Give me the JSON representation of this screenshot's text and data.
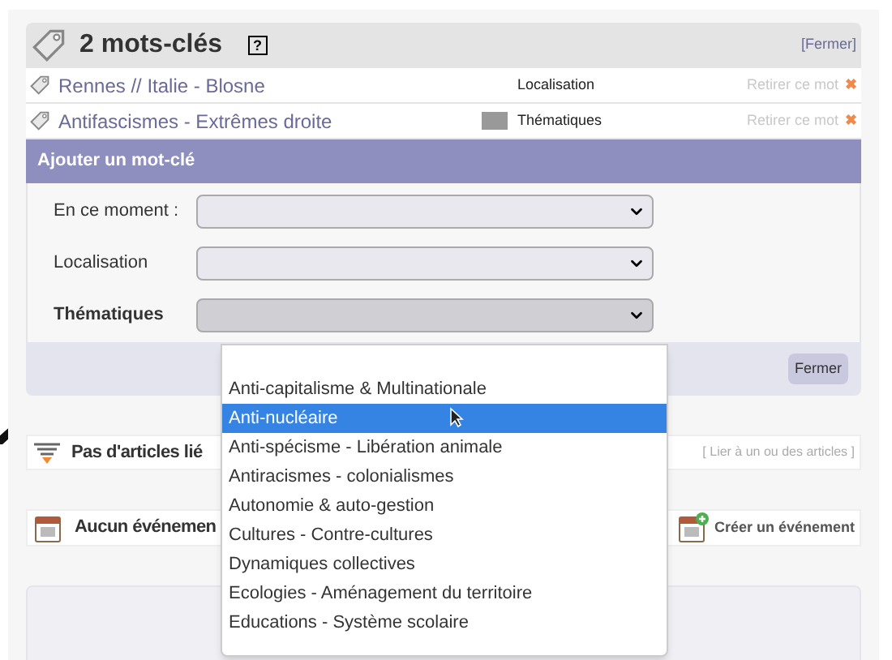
{
  "keywords_panel": {
    "title": "2 mots-clés",
    "help": "?",
    "close": "[Fermer]",
    "items": [
      {
        "label": "Rennes // Italie - Blosne",
        "group": "Localisation",
        "has_image": false,
        "remove": "Retirer ce mot",
        "remove_icon": "✖"
      },
      {
        "label": "Antifascismes - Extrêmes droite",
        "group": "Thématiques",
        "has_image": true,
        "remove": "Retirer ce mot",
        "remove_icon": "✖"
      }
    ]
  },
  "add_form": {
    "title": "Ajouter un mot-clé",
    "fields": [
      {
        "label": "En ce moment :",
        "bold": false,
        "focused": false
      },
      {
        "label": "Localisation",
        "bold": false,
        "focused": false
      },
      {
        "label": "Thématiques",
        "bold": true,
        "focused": true
      }
    ],
    "close_button": "Fermer"
  },
  "dropdown": {
    "options": [
      {
        "label": "Anti-capitalisme & Multinationale",
        "selected": false
      },
      {
        "label": "Anti-nucléaire",
        "selected": true
      },
      {
        "label": "Anti-spécisme - Libération animale",
        "selected": false
      },
      {
        "label": "Antiracismes - colonialismes",
        "selected": false
      },
      {
        "label": "Autonomie & auto-gestion",
        "selected": false
      },
      {
        "label": "Cultures - Contre-cultures",
        "selected": false
      },
      {
        "label": "Dynamiques collectives",
        "selected": false
      },
      {
        "label": "Ecologies - Aménagement du territoire",
        "selected": false
      },
      {
        "label": "Educations - Système scolaire",
        "selected": false
      }
    ]
  },
  "articles": {
    "title": "Pas d'articles lié",
    "link": "[ Lier à un ou des articles ]"
  },
  "events": {
    "title": "Aucun événemen",
    "link": "Créer un événement"
  }
}
